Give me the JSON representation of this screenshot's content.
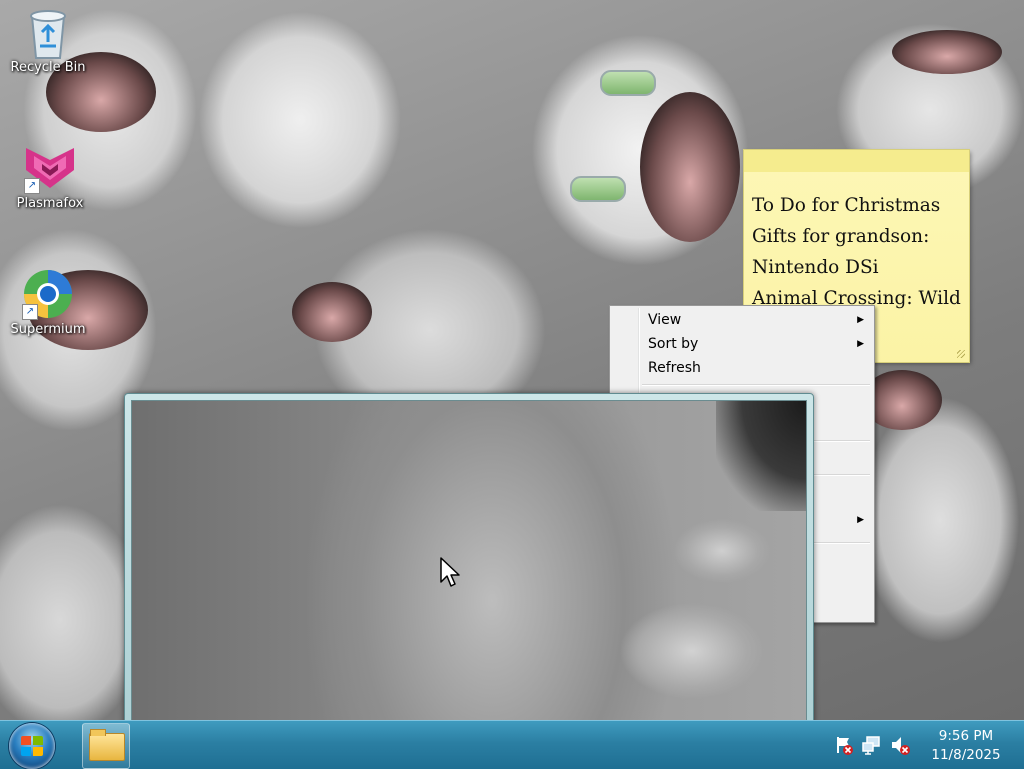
{
  "desktop": {
    "icons": [
      {
        "label": "Recycle Bin",
        "icon": "recycle-bin-icon"
      },
      {
        "label": "Plasmafox",
        "icon": "plasmafox-icon"
      },
      {
        "label": "Supermium",
        "icon": "supermium-icon"
      }
    ]
  },
  "sticky_note": {
    "lines": [
      "To Do for Christmas",
      "Gifts for grandson:",
      "Nintendo DSi",
      "Animal Crossing: Wild"
    ]
  },
  "context_menu": {
    "items": [
      {
        "label": "View",
        "has_submenu": true
      },
      {
        "label": "Sort by",
        "has_submenu": true
      },
      {
        "label": "Refresh",
        "has_submenu": false
      }
    ]
  },
  "taskbar": {
    "start_icon": "windows-logo-icon",
    "pinned": [
      {
        "icon": "folder-icon"
      }
    ],
    "tray": {
      "icons": [
        "action-center-flag-icon",
        "network-icon",
        "volume-muted-icon"
      ],
      "time": "9:56 PM",
      "date": "11/8/2025"
    }
  },
  "colors": {
    "taskbar": "#2b7fa3",
    "sticky_note": "#fdf7b6",
    "menu_bg": "#f0f0f0",
    "preview_frame": "#a9ced2"
  }
}
